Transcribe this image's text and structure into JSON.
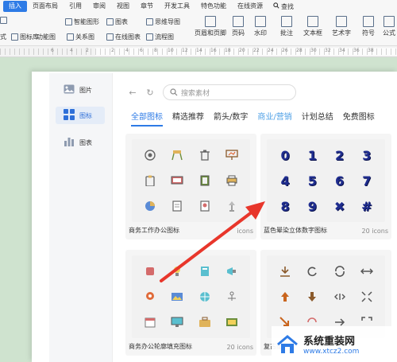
{
  "menubar": {
    "items": [
      "插入",
      "页面布局",
      "引用",
      "审阅",
      "视图",
      "章节",
      "开发工具",
      "特色功能",
      "在线资源"
    ],
    "search_label": "查找"
  },
  "ribbon": {
    "items": [
      "智能图形",
      "图表",
      "思维导图",
      "页眉和页脚",
      "页码",
      "水印",
      "批注",
      "文本框",
      "艺术字",
      "符号",
      "公式",
      "式",
      "图标库",
      "功能图",
      "关系图",
      "在线图表",
      "流程图"
    ]
  },
  "ruler": {
    "numbers": [
      "6",
      "4",
      "2",
      "2",
      "4",
      "6",
      "8",
      "10",
      "12",
      "14",
      "16",
      "18",
      "20",
      "22",
      "24",
      "26",
      "28",
      "30",
      "32",
      "34",
      "36",
      "38"
    ]
  },
  "sidebar": {
    "items": [
      {
        "label": "图片",
        "icon": "image-icon"
      },
      {
        "label": "图标",
        "icon": "grid-icon"
      },
      {
        "label": "图表",
        "icon": "chart-icon"
      }
    ]
  },
  "panel": {
    "search_placeholder": "搜索素材",
    "tabs": [
      "全部图标",
      "精选推荐",
      "箭头/数字",
      "商业/营销",
      "计划总结",
      "免费图标"
    ],
    "cards": [
      {
        "title": "商务工作办公图标",
        "count": "icons"
      },
      {
        "title": "蓝色晕染立体数字图标",
        "count": "20 icons",
        "glyphs": [
          "0",
          "1",
          "2",
          "3",
          "4",
          "5",
          "6",
          "7",
          "8",
          "9",
          "✖",
          "#"
        ]
      },
      {
        "title": "商务办公轮廓填充图标",
        "count": "20 icons"
      },
      {
        "title": "复古配色",
        "count": ""
      }
    ]
  },
  "watermark": {
    "name": "系统重装网",
    "url": "www.xtcz2.com"
  },
  "colors": {
    "accent": "#2e7be6",
    "arrow": "#e8362b",
    "number_icon": "#1f2d8f"
  }
}
